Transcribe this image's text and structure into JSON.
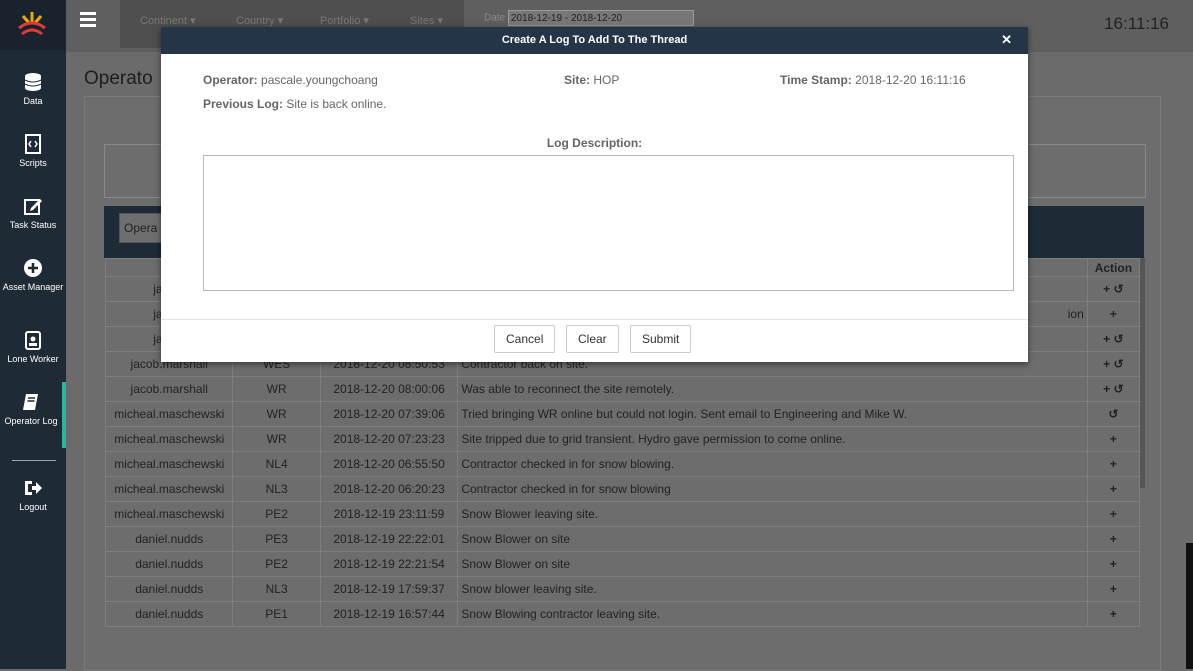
{
  "app": {
    "clock": "16:11:16",
    "page_title": "Operato"
  },
  "filters": {
    "continent": "Continent",
    "country": "Country",
    "portfolio": "Portfolio",
    "sites": "Sites",
    "date_label": "Date",
    "date_value": "2018-12-19 - 2018-12-20"
  },
  "sidebar": {
    "items": [
      {
        "label": "Data",
        "icon": "database-icon"
      },
      {
        "label": "Scripts",
        "icon": "script-icon"
      },
      {
        "label": "Task Status",
        "icon": "edit-icon"
      },
      {
        "label": "Asset Manager",
        "icon": "plus-circle-icon"
      },
      {
        "label": "Lone Worker",
        "icon": "badge-icon"
      },
      {
        "label": "Operator Log",
        "icon": "book-icon",
        "active": true
      },
      {
        "label": "Logout",
        "icon": "logout-icon"
      }
    ]
  },
  "operator_select": "Opera",
  "table": {
    "headers": [
      "Op",
      "",
      "",
      "",
      "Action"
    ],
    "rows": [
      {
        "operator": "jacob.",
        "site": "",
        "time": "",
        "desc": "",
        "action": "+ ↺"
      },
      {
        "operator": "jacob.",
        "site": "",
        "time": "",
        "desc": "ion",
        "action": "+"
      },
      {
        "operator": "jacob.",
        "site": "",
        "time": "",
        "desc": "",
        "action": "+ ↺"
      },
      {
        "operator": "jacob.marshall",
        "site": "WES",
        "time": "2018-12-20 08:50:53",
        "desc": "Contractor back on site.",
        "action": "+ ↺"
      },
      {
        "operator": "jacob.marshall",
        "site": "WR",
        "time": "2018-12-20 08:00:06",
        "desc": "Was able to reconnect the site remotely.",
        "action": "+ ↺"
      },
      {
        "operator": "micheal.maschewski",
        "site": "WR",
        "time": "2018-12-20 07:39:06",
        "desc": "Tried bringing WR online but could not login. Sent email to Engineering and Mike W.",
        "action": "↺"
      },
      {
        "operator": "micheal.maschewski",
        "site": "WR",
        "time": "2018-12-20 07:23:23",
        "desc": "Site tripped due to grid transient. Hydro gave permission to come online.",
        "action": "+"
      },
      {
        "operator": "micheal.maschewski",
        "site": "NL4",
        "time": "2018-12-20 06:55:50",
        "desc": "Contractor checked in for snow blowing.",
        "action": "+"
      },
      {
        "operator": "micheal.maschewski",
        "site": "NL3",
        "time": "2018-12-20 06:20:23",
        "desc": "Contractor checked in for snow blowing",
        "action": "+"
      },
      {
        "operator": "micheal.maschewski",
        "site": "PE2",
        "time": "2018-12-19 23:11:59",
        "desc": "Snow Blower leaving site.",
        "action": "+"
      },
      {
        "operator": "daniel.nudds",
        "site": "PE3",
        "time": "2018-12-19 22:22:01",
        "desc": "Snow Blower on site",
        "action": "+"
      },
      {
        "operator": "daniel.nudds",
        "site": "PE2",
        "time": "2018-12-19 22:21:54",
        "desc": "Snow Blower on site",
        "action": "+"
      },
      {
        "operator": "daniel.nudds",
        "site": "NL3",
        "time": "2018-12-19 17:59:37",
        "desc": "Snow blower leaving site.",
        "action": "+"
      },
      {
        "operator": "daniel.nudds",
        "site": "PE1",
        "time": "2018-12-19 16:57:44",
        "desc": "Snow Blowing contractor leaving site.",
        "action": "+"
      }
    ]
  },
  "modal": {
    "title": "Create A Log To Add To The Thread",
    "close": "✕",
    "operator_label": "Operator:",
    "operator_value": "pascale.youngchoang",
    "site_label": "Site:",
    "site_value": "HOP",
    "timestamp_label": "Time Stamp:",
    "timestamp_value": "2018-12-20 16:11:16",
    "prev_label": "Previous Log:",
    "prev_value": "Site is back online.",
    "desc_label": "Log Description:",
    "desc_value": "",
    "buttons": {
      "cancel": "Cancel",
      "clear": "Clear",
      "submit": "Submit"
    }
  }
}
